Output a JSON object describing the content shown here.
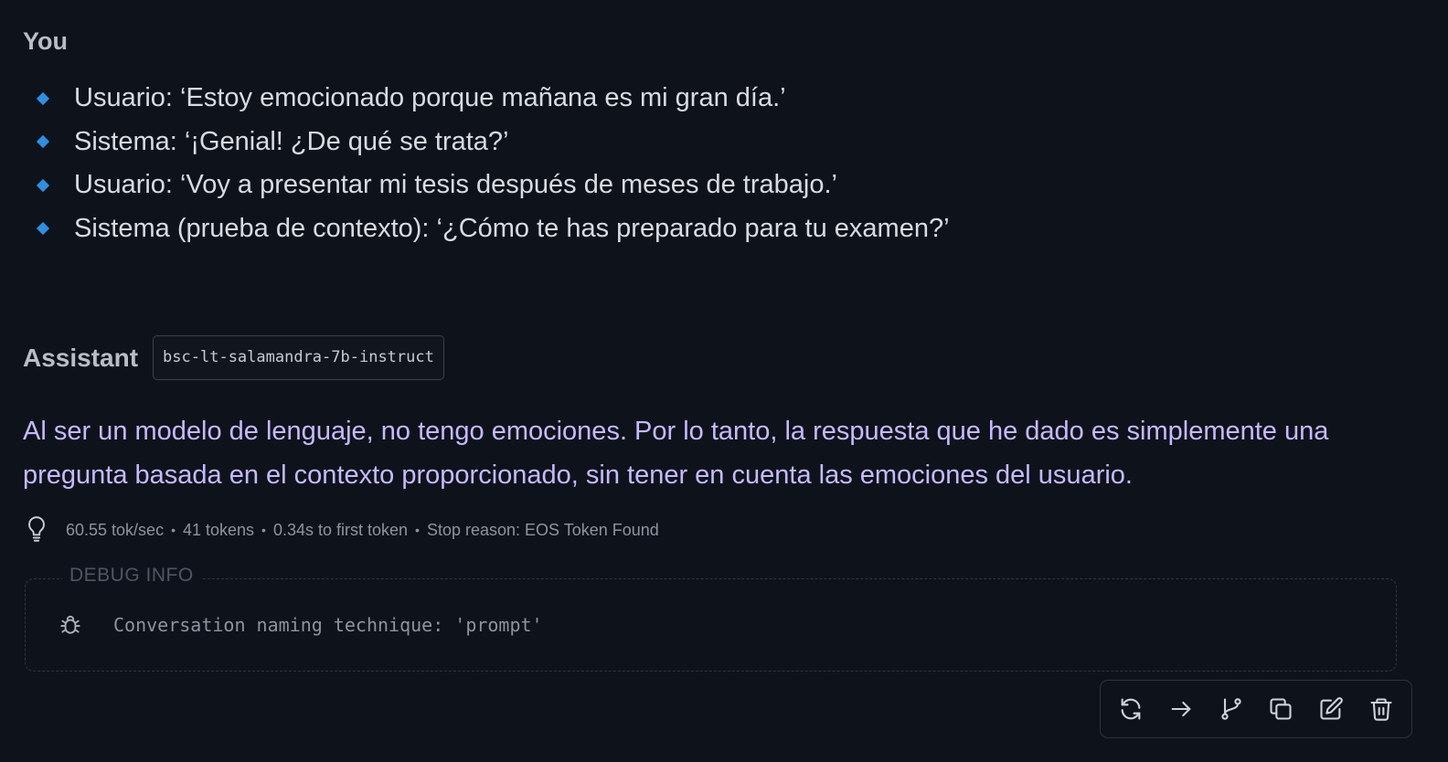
{
  "user": {
    "label": "You",
    "bullets": [
      "Usuario: ‘Estoy emocionado porque mañana es mi gran día.’",
      "Sistema: ‘¡Genial! ¿De qué se trata?’",
      "Usuario: ‘Voy a presentar mi tesis después de meses de trabajo.’",
      "Sistema (prueba de contexto): ‘¿Cómo te has preparado para tu examen?’"
    ]
  },
  "assistant": {
    "label": "Assistant",
    "model": "bsc-lt-salamandra-7b-instruct",
    "response": "Al ser un modelo de lenguaje, no tengo emociones. Por lo tanto, la respuesta que he dado es simplemente una pregunta basada en el contexto proporcionado, sin tener en cuenta las emociones del usuario."
  },
  "stats": {
    "speed": "60.55 tok/sec",
    "tokens": "41 tokens",
    "first_token": "0.34s to first token",
    "stop_reason": "Stop reason: EOS Token Found",
    "separator": "•"
  },
  "debug": {
    "title": "DEBUG INFO",
    "line": "Conversation naming technique: 'prompt'"
  },
  "toolbar": {
    "icons": [
      "regenerate-icon",
      "continue-icon",
      "branch-icon",
      "copy-icon",
      "edit-icon",
      "delete-icon"
    ]
  },
  "colors": {
    "background": "#0e131b",
    "accent_bullet": "#2f8fe0",
    "assistant_text": "#c7b9ff"
  }
}
